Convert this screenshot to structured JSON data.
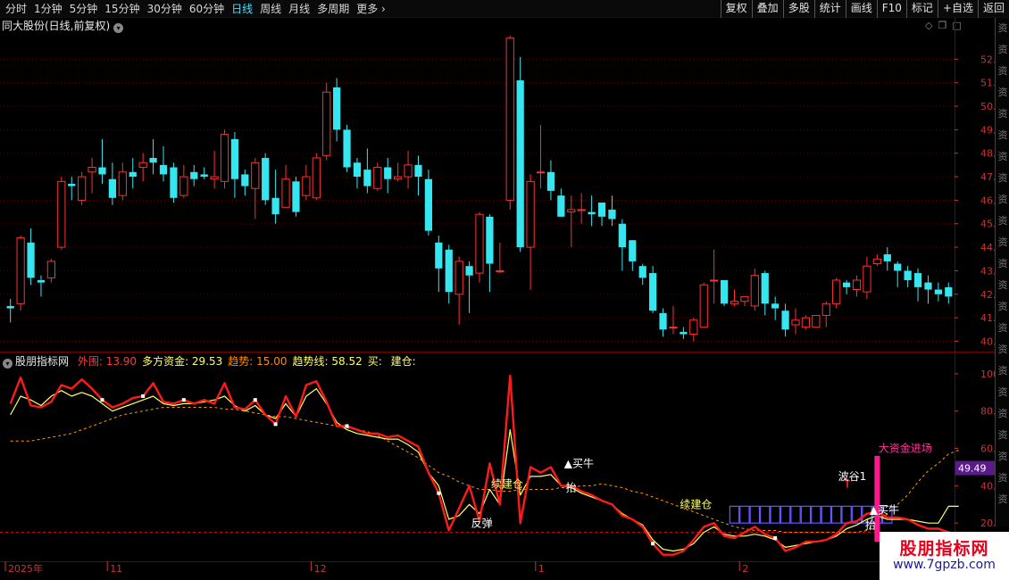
{
  "toolbar": {
    "periods": [
      "分时",
      "1分钟",
      "5分钟",
      "15分钟",
      "30分钟",
      "60分钟",
      "日线",
      "周线",
      "月线",
      "多周期",
      "更多"
    ],
    "active_period": "日线",
    "tools": [
      "复权",
      "叠加",
      "多股",
      "统计",
      "画线",
      "F10",
      "标记",
      "+自选",
      "返回"
    ]
  },
  "main_panel": {
    "title": "同大股份(日线,前复权)",
    "corner_icons": [
      "diamond-icon",
      "copy-icon",
      "maximize-icon"
    ]
  },
  "indicator_panel": {
    "name": "股朋指标网",
    "items": [
      {
        "label": "外围: ",
        "value": "13.90",
        "label_color": "#ff3b3b",
        "value_color": "#ff3b3b"
      },
      {
        "label": "多方资金: ",
        "value": "29.53",
        "label_color": "#ffff66",
        "value_color": "#ffff66"
      },
      {
        "label": "趋势: ",
        "value": "15.00",
        "label_color": "#ff8c00",
        "value_color": "#ff8c00"
      },
      {
        "label": "趋势线: ",
        "value": "58.52",
        "label_color": "#ffff66",
        "value_color": "#ffff66"
      },
      {
        "label": "买: ",
        "value": "",
        "label_color": "#ffff66",
        "value_color": "#ffff66"
      },
      {
        "label": "建仓: ",
        "value": "",
        "label_color": "#ffff66",
        "value_color": "#ffff66"
      }
    ],
    "value_tag": "49.49",
    "annotations": [
      {
        "text": "反弹",
        "color": "#ffffff"
      },
      {
        "text": "续建仓",
        "color": "#ffff66"
      },
      {
        "text": "▲买牛",
        "color": "#ffffff"
      },
      {
        "text": "抬",
        "color": "#ffffff"
      },
      {
        "text": "续建仓",
        "color": "#ffff66"
      },
      {
        "text": "波谷1",
        "color": "#ffffff"
      },
      {
        "text": "大资金进场",
        "color": "#ff3399"
      },
      {
        "text": "▲买牛",
        "color": "#ffffff"
      },
      {
        "text": "抬",
        "color": "#ffffff"
      }
    ]
  },
  "sidebar": {
    "items": [
      "资",
      "资",
      "资",
      "资",
      "资",
      "资",
      "资",
      "资",
      "资",
      "资",
      "资",
      "资",
      "资",
      "资",
      "资",
      "资",
      "资",
      "资",
      "资",
      "资",
      "资",
      "资",
      "资"
    ]
  },
  "watermark": {
    "cn": "股朋指标网",
    "url": "www.7gpzb.com"
  },
  "colors": {
    "up": "#ff3030",
    "down": "#35e6f0",
    "grid": "#5a0000",
    "axis_text": "#cc3333",
    "waiguo_line": "#ff1a1a",
    "duofang_line": "#ffff66",
    "trend_line": "#ff9900",
    "signal_bar": "#ff1a8c",
    "box": "#6655ff"
  },
  "chart_data": [
    {
      "type": "candlestick",
      "title": "同大股份(日线,前复权)",
      "ylim": [
        39.6,
        53.0
      ],
      "y_ticks": [
        40.0,
        41.0,
        42.0,
        43.0,
        44.0,
        45.0,
        46.0,
        47.0,
        48.0,
        49.0,
        50.0,
        51.0,
        52.0
      ],
      "x_labels": [
        "2025年",
        "11",
        "12",
        "1",
        "2"
      ],
      "x_label_index": [
        0,
        10,
        30,
        52,
        72
      ],
      "ohlc": [
        [
          41.5,
          41.8,
          41.4,
          40.8
        ],
        [
          41.6,
          44.5,
          44.4,
          41.3
        ],
        [
          44.2,
          44.8,
          42.7,
          42.4
        ],
        [
          42.6,
          42.8,
          42.5,
          41.9
        ],
        [
          42.7,
          43.5,
          43.4,
          42.5
        ],
        [
          44.0,
          47.0,
          46.8,
          43.9
        ],
        [
          46.7,
          47.0,
          46.6,
          46.0
        ],
        [
          46.0,
          47.2,
          47.0,
          45.8
        ],
        [
          47.2,
          47.8,
          47.4,
          46.3
        ],
        [
          47.4,
          48.6,
          47.1,
          46.7
        ],
        [
          46.9,
          47.6,
          46.1,
          45.8
        ],
        [
          46.2,
          47.6,
          47.2,
          46.0
        ],
        [
          47.2,
          47.8,
          47.0,
          46.5
        ],
        [
          47.4,
          48.0,
          47.6,
          46.8
        ],
        [
          47.8,
          48.6,
          47.6,
          47.1
        ],
        [
          47.5,
          48.3,
          47.1,
          46.8
        ],
        [
          47.4,
          47.6,
          46.1,
          45.9
        ],
        [
          46.2,
          47.5,
          47.0,
          46.1
        ],
        [
          47.2,
          47.5,
          46.9,
          46.6
        ],
        [
          47.1,
          47.4,
          47.0,
          46.9
        ],
        [
          46.9,
          48.1,
          47.0,
          46.5
        ],
        [
          46.8,
          49.0,
          48.8,
          46.5
        ],
        [
          48.6,
          48.9,
          46.9,
          46.1
        ],
        [
          47.1,
          47.3,
          46.6,
          46.2
        ],
        [
          46.5,
          47.8,
          47.6,
          45.2
        ],
        [
          47.8,
          48.0,
          46.0,
          45.8
        ],
        [
          46.1,
          47.3,
          45.4,
          45.0
        ],
        [
          45.7,
          47.5,
          46.9,
          46.0
        ],
        [
          46.8,
          47.0,
          45.5,
          45.3
        ],
        [
          46.2,
          47.5,
          47.0,
          46.0
        ],
        [
          46.1,
          48.0,
          47.8,
          46.0
        ],
        [
          47.9,
          51.0,
          50.6,
          47.7
        ],
        [
          50.8,
          51.2,
          49.0,
          48.5
        ],
        [
          49.0,
          49.2,
          47.4,
          47.2
        ],
        [
          47.6,
          47.8,
          47.0,
          46.5
        ],
        [
          47.3,
          48.2,
          46.6,
          46.3
        ],
        [
          46.5,
          47.6,
          47.4,
          46.4
        ],
        [
          47.4,
          47.8,
          46.9,
          46.3
        ],
        [
          46.9,
          47.6,
          47.0,
          46.8
        ],
        [
          47.0,
          48.1,
          47.5,
          46.5
        ],
        [
          47.5,
          47.9,
          47.0,
          46.2
        ],
        [
          46.9,
          47.3,
          44.7,
          44.5
        ],
        [
          44.2,
          44.5,
          43.1,
          42.1
        ],
        [
          43.9,
          44.1,
          42.1,
          41.6
        ],
        [
          42.0,
          43.6,
          43.4,
          40.7
        ],
        [
          43.2,
          43.4,
          42.8,
          41.2
        ],
        [
          42.9,
          45.5,
          45.4,
          42.5
        ],
        [
          45.3,
          45.4,
          43.3,
          42.1
        ],
        [
          43.0,
          44.2,
          43.0,
          42.9
        ],
        [
          46.0,
          53.0,
          52.9,
          45.6
        ],
        [
          51.1,
          52.1,
          44.0,
          43.8
        ],
        [
          44.0,
          47.1,
          46.8,
          42.2
        ],
        [
          47.2,
          49.2,
          47.2,
          46.5
        ],
        [
          47.2,
          47.7,
          46.4,
          46.0
        ],
        [
          46.2,
          46.5,
          45.3,
          45.3
        ],
        [
          45.5,
          46.2,
          45.6,
          44.0
        ],
        [
          45.6,
          46.3,
          45.6,
          45.0
        ],
        [
          45.5,
          46.2,
          45.4,
          44.9
        ],
        [
          45.9,
          45.9,
          45.3,
          44.9
        ],
        [
          45.6,
          46.2,
          45.2,
          44.9
        ],
        [
          45.0,
          45.2,
          44.0,
          43.0
        ],
        [
          44.3,
          44.3,
          43.4,
          43.0
        ],
        [
          43.2,
          43.3,
          42.7,
          42.4
        ],
        [
          42.9,
          43.2,
          41.3,
          41.2
        ],
        [
          41.2,
          41.4,
          40.5,
          40.2
        ],
        [
          40.6,
          41.5,
          40.6,
          40.3
        ],
        [
          40.4,
          40.6,
          40.3,
          40.1
        ],
        [
          40.3,
          41.0,
          40.9,
          40.0
        ],
        [
          40.6,
          42.5,
          42.4,
          40.7
        ],
        [
          42.6,
          43.9,
          42.6,
          41.6
        ],
        [
          42.6,
          42.6,
          41.6,
          41.5
        ],
        [
          41.6,
          42.2,
          41.7,
          41.5
        ],
        [
          41.7,
          41.9,
          41.9,
          41.5
        ],
        [
          41.5,
          43.1,
          42.8,
          41.3
        ],
        [
          42.9,
          43.0,
          41.6,
          41.1
        ],
        [
          41.6,
          41.9,
          41.4,
          40.9
        ],
        [
          41.3,
          41.6,
          40.5,
          40.2
        ],
        [
          40.7,
          41.4,
          40.9,
          40.3
        ],
        [
          40.6,
          41.1,
          41.0,
          40.5
        ],
        [
          40.6,
          41.1,
          41.1,
          40.6
        ],
        [
          41.1,
          41.7,
          41.6,
          40.6
        ],
        [
          41.6,
          42.7,
          42.6,
          41.4
        ],
        [
          42.5,
          42.6,
          42.3,
          42.0
        ],
        [
          42.2,
          42.8,
          42.6,
          41.9
        ],
        [
          42.1,
          43.6,
          43.2,
          41.8
        ],
        [
          43.3,
          43.7,
          43.5,
          43.2
        ],
        [
          43.7,
          44.0,
          43.4,
          43.0
        ],
        [
          43.3,
          43.4,
          43.0,
          42.3
        ],
        [
          43.0,
          43.2,
          42.6,
          42.3
        ],
        [
          42.9,
          43.1,
          42.3,
          41.7
        ],
        [
          42.5,
          42.8,
          42.2,
          41.6
        ],
        [
          42.2,
          42.5,
          42.0,
          41.7
        ],
        [
          42.3,
          42.5,
          41.9,
          41.6
        ]
      ]
    },
    {
      "type": "line",
      "title": "股朋指标网",
      "ylim": [
        0,
        110
      ],
      "y_ticks": [
        20.0,
        40.0,
        60.0,
        80.0,
        100.0
      ],
      "series": [
        {
          "name": "外围",
          "values": [
            84,
            98,
            83,
            82,
            85,
            94,
            92,
            97,
            92,
            86,
            82,
            84,
            87,
            88,
            95,
            85,
            84,
            86,
            84,
            86,
            84,
            95,
            82,
            81,
            86,
            78,
            73,
            88,
            77,
            94,
            96,
            85,
            72,
            72,
            70,
            68,
            68,
            66,
            67,
            64,
            61,
            47,
            36,
            16,
            28,
            40,
            21,
            52,
            30,
            99,
            20,
            50,
            47,
            50,
            40,
            40,
            37,
            35,
            32,
            30,
            24,
            22,
            18,
            9,
            3,
            3,
            5,
            11,
            18,
            20,
            13,
            12,
            15,
            18,
            14,
            12,
            5,
            7,
            10,
            10,
            11,
            14,
            20,
            21,
            25,
            26,
            23,
            23,
            22,
            19,
            17,
            17,
            15,
            14
          ]
        },
        {
          "name": "多方资金",
          "values": [
            78,
            88,
            86,
            83,
            88,
            91,
            88,
            90,
            88,
            84,
            80,
            82,
            84,
            86,
            88,
            84,
            83,
            84,
            84,
            85,
            86,
            88,
            83,
            80,
            83,
            78,
            76,
            84,
            77,
            88,
            92,
            84,
            74,
            70,
            68,
            67,
            66,
            65,
            65,
            62,
            58,
            47,
            40,
            22,
            24,
            30,
            25,
            38,
            30,
            70,
            35,
            45,
            45,
            46,
            40,
            39,
            36,
            34,
            32,
            30,
            25,
            22,
            19,
            11,
            6,
            5,
            6,
            9,
            15,
            18,
            14,
            13,
            13,
            14,
            13,
            11,
            7,
            8,
            9,
            10,
            11,
            13,
            17,
            19,
            22,
            24,
            22,
            22,
            22,
            21,
            20,
            20,
            29,
            29
          ]
        },
        {
          "name": "趋势线",
          "values": [
            64,
            64,
            64,
            65,
            66,
            67,
            68,
            70,
            72,
            74,
            76,
            78,
            79,
            80,
            81,
            82,
            82,
            82,
            82,
            82,
            82,
            81,
            81,
            80,
            79,
            78,
            77,
            77,
            76,
            75,
            74,
            73,
            72,
            71,
            70,
            69,
            67,
            64,
            61,
            58,
            55,
            51,
            47,
            45,
            42,
            40,
            38,
            38,
            37,
            37,
            38,
            38,
            38,
            38,
            39,
            39,
            40,
            40,
            41,
            40,
            39,
            37,
            36,
            34,
            32,
            30,
            28,
            26,
            24,
            22,
            20,
            18,
            17,
            16,
            16,
            16,
            15,
            15,
            15,
            15,
            15,
            15,
            15,
            15,
            16,
            20,
            25,
            30,
            35,
            42,
            48,
            52,
            57,
            59
          ]
        }
      ]
    }
  ]
}
